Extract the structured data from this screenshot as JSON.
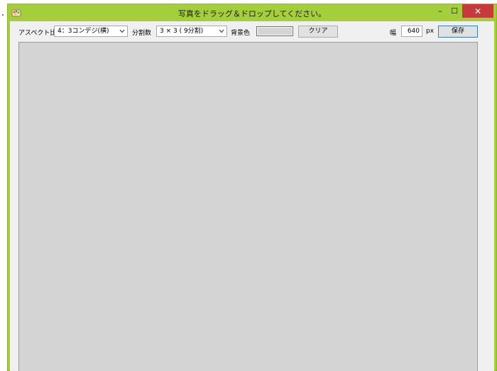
{
  "window": {
    "title": "写真をドラッグ＆ドロップしてください。",
    "icon": "app-paint-icon",
    "controls": {
      "minimize": "–",
      "maximize": "☐",
      "close": "✕"
    }
  },
  "toolbar": {
    "aspect_label": "アスペクト比",
    "aspect_value": "4：3コンデジ(横)",
    "split_label": "分割数",
    "split_value": "3 × 3 ( 9分割)",
    "bg_label": "背景色",
    "bg_color": "#d4d4d4",
    "clear_label": "クリア",
    "width_label": "幅",
    "width_value": "640",
    "unit_label": "px",
    "save_label": "保存"
  },
  "colors": {
    "titlebar": "#a4cf3a",
    "close_button": "#c73a3a",
    "canvas": "#d4d4d4",
    "client": "#f0f0f0"
  }
}
